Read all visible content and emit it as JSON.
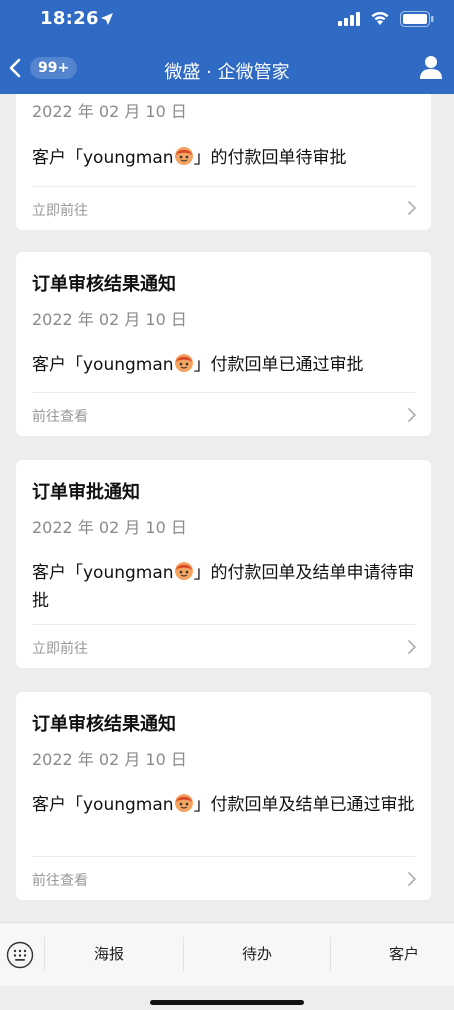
{
  "status_bar": {
    "time": "18:26"
  },
  "nav": {
    "badge": "99+",
    "title": "微盛 · 企微管家"
  },
  "cards": [
    {
      "date": "2022 年 02 月 10 日",
      "body_pre": "客户「youngman",
      "body_post": "」的付款回单待审批",
      "link": "立即前往"
    },
    {
      "title": "订单审核结果通知",
      "date": "2022 年 02 月 10 日",
      "body_pre": "客户「youngman",
      "body_post": "」付款回单已通过审批",
      "link": "前往查看"
    },
    {
      "title": "订单审批通知",
      "date": "2022 年 02 月 10 日",
      "body_pre": "客户「youngman",
      "body_post": "」的付款回单及结单申请待审批",
      "link": "立即前往"
    },
    {
      "title": "订单审核结果通知",
      "date": "2022 年 02 月 10 日",
      "body_pre": "客户「youngman",
      "body_post": "」付款回单及结单已通过审批",
      "link": "前往查看"
    }
  ],
  "toolbar": {
    "tabs": [
      "海报",
      "待办",
      "客户"
    ]
  },
  "colors": {
    "nav_bg": "#2f6ac4",
    "page_bg": "#ededed",
    "card_bg": "#ffffff"
  },
  "icons": [
    "location-arrow-icon",
    "signal-icon",
    "wifi-icon",
    "battery-icon",
    "back-chevron-icon",
    "profile-icon",
    "chevron-right-icon",
    "keyboard-icon",
    "avatar-emoji-icon"
  ]
}
